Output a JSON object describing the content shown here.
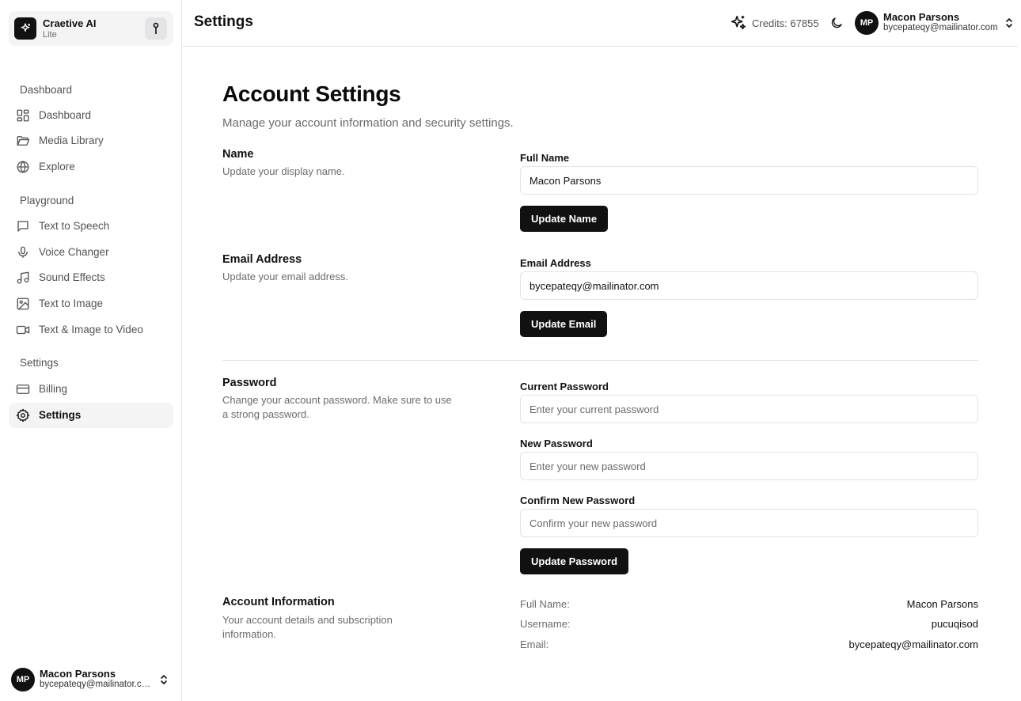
{
  "brand": {
    "name": "Craetive AI",
    "plan": "Lite"
  },
  "sidebar": {
    "groups": [
      {
        "label": "Dashboard"
      },
      {
        "label": "Playground"
      },
      {
        "label": "Settings"
      }
    ],
    "items": [
      {
        "label": "Dashboard",
        "icon": "grid-icon"
      },
      {
        "label": "Media Library",
        "icon": "folder-icon"
      },
      {
        "label": "Explore",
        "icon": "globe-icon"
      },
      {
        "label": "Text to Speech",
        "icon": "message-square-icon"
      },
      {
        "label": "Voice Changer",
        "icon": "microphone-icon"
      },
      {
        "label": "Sound Effects",
        "icon": "music-note-icon"
      },
      {
        "label": "Text to Image",
        "icon": "image-icon"
      },
      {
        "label": "Text & Image to Video",
        "icon": "video-icon"
      },
      {
        "label": "Billing",
        "icon": "credit-card-icon"
      },
      {
        "label": "Settings",
        "icon": "gear-icon",
        "active": true
      }
    ]
  },
  "user": {
    "initials": "MP",
    "name": "Macon Parsons",
    "email": "bycepateqy@mailinator.com"
  },
  "header": {
    "title": "Settings",
    "credits": "Credits: 67855"
  },
  "main": {
    "title": "Account Settings",
    "subtitle": "Manage your account information and security settings.",
    "name_section": {
      "title": "Name",
      "description": "Update your display name.",
      "field_label": "Full Name",
      "value": "Macon Parsons",
      "button": "Update Name"
    },
    "email_section": {
      "title": "Email Address",
      "description": "Update your email address.",
      "field_label": "Email Address",
      "value": "bycepateqy@mailinator.com",
      "button": "Update Email"
    },
    "password_section": {
      "title": "Password",
      "description": "Change your account password. Make sure to use a strong password.",
      "current_label": "Current Password",
      "current_placeholder": "Enter your current password",
      "new_label": "New Password",
      "new_placeholder": "Enter your new password",
      "confirm_label": "Confirm New Password",
      "confirm_placeholder": "Confirm your new password",
      "button": "Update Password"
    },
    "account_info": {
      "title": "Account Information",
      "description": "Your account details and subscription information.",
      "rows": [
        {
          "key": "Full Name:",
          "value": "Macon Parsons"
        },
        {
          "key": "Username:",
          "value": "pucuqisod"
        },
        {
          "key": "Email:",
          "value": "bycepateqy@mailinator.com"
        }
      ]
    }
  },
  "colors": {
    "primary": "#111111",
    "muted_text": "#6b6b6b",
    "border": "#e5e5e5",
    "active_bg": "#f4f4f5"
  }
}
